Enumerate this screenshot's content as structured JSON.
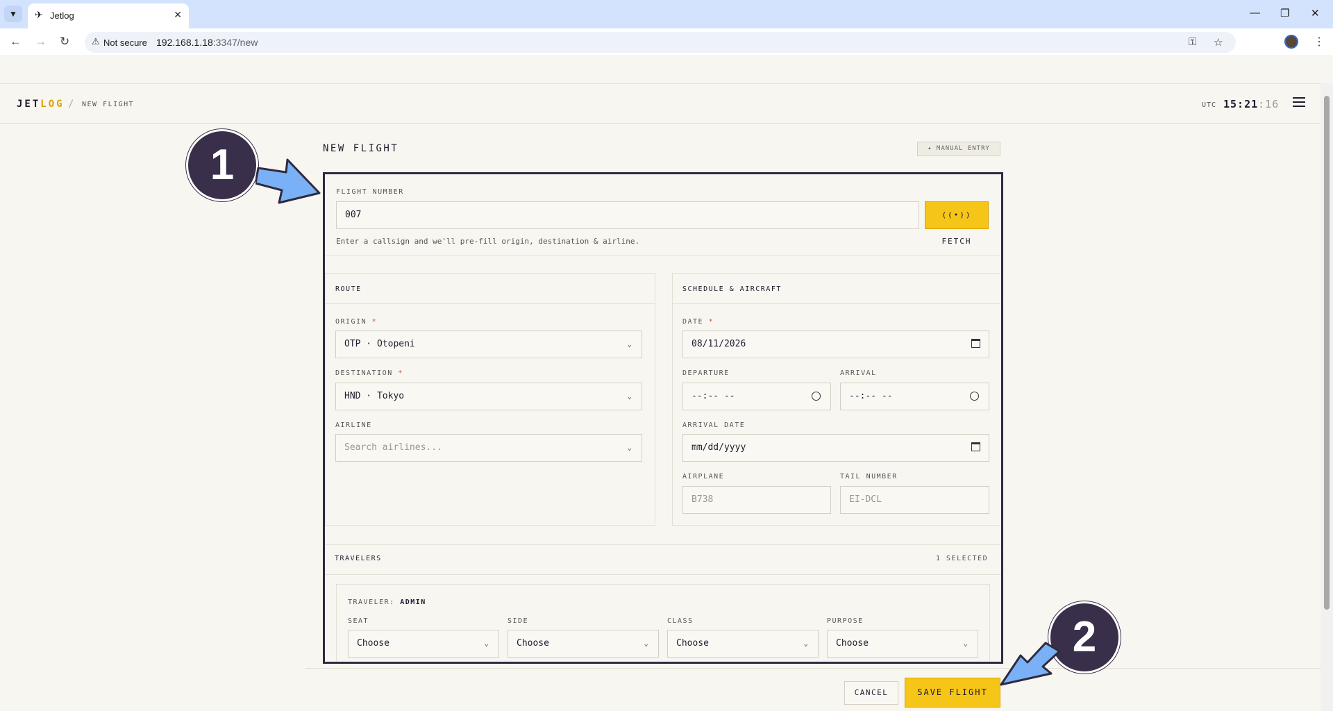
{
  "browser": {
    "tab_title": "Jetlog",
    "not_secure": "Not secure",
    "url_host": "192.168.1.18",
    "url_rest": ":3347/new"
  },
  "header": {
    "brand_jet": "JET",
    "brand_log": "LOG",
    "separator": "/",
    "crumb": "NEW FLIGHT",
    "utc_label": "UTC",
    "utc_hm": "15:21",
    "utc_sec": ":16"
  },
  "page": {
    "title": "NEW FLIGHT",
    "manual_entry": "MANUAL ENTRY"
  },
  "flight_number": {
    "label": "FLIGHT NUMBER",
    "value": "007",
    "fetch": "FETCH",
    "hint": "Enter a callsign and we'll pre-fill origin, destination & airline."
  },
  "route": {
    "title": "ROUTE",
    "origin_label": "ORIGIN",
    "origin_value": "OTP · Otopeni",
    "destination_label": "DESTINATION",
    "destination_value": "HND · Tokyo",
    "airline_label": "AIRLINE",
    "airline_placeholder": "Search airlines..."
  },
  "schedule": {
    "title": "SCHEDULE & AIRCRAFT",
    "date_label": "DATE",
    "date_value": "08/11/2026",
    "departure_label": "DEPARTURE",
    "departure_value": "--:-- --",
    "arrival_label": "ARRIVAL",
    "arrival_value": "--:-- --",
    "arrival_date_label": "ARRIVAL DATE",
    "arrival_date_value": "mm/dd/yyyy",
    "airplane_label": "AIRPLANE",
    "airplane_placeholder": "B738",
    "tail_label": "TAIL NUMBER",
    "tail_placeholder": "EI-DCL"
  },
  "travelers": {
    "title": "TRAVELERS",
    "count": "1 SELECTED",
    "traveler_prefix": "TRAVELER:",
    "traveler_name": "ADMIN",
    "seat_label": "SEAT",
    "side_label": "SIDE",
    "class_label": "CLASS",
    "purpose_label": "PURPOSE",
    "choose": "Choose"
  },
  "footer": {
    "cancel": "CANCEL",
    "save": "SAVE FLIGHT"
  },
  "annotations": {
    "badge1": "1",
    "badge2": "2"
  },
  "colors": {
    "accent": "#f5c518",
    "dark": "#2e2a40",
    "badge": "#3a2f4a",
    "arrow": "#7ab0f5"
  }
}
